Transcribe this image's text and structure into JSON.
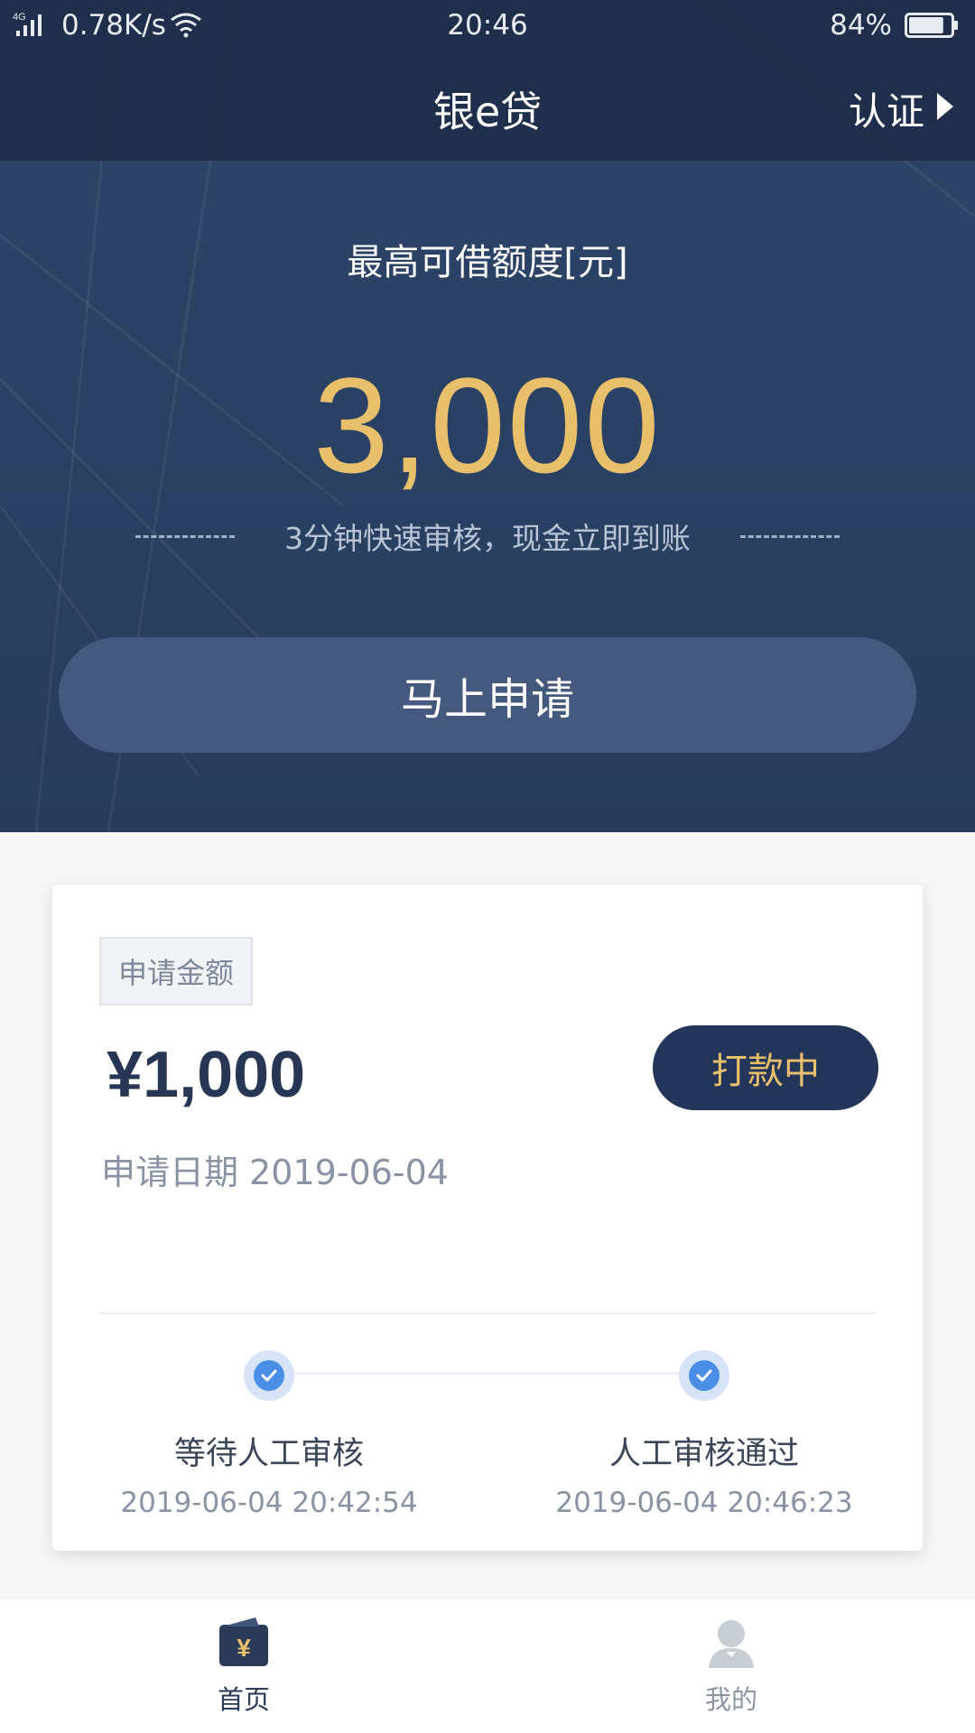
{
  "status_bar": {
    "network_type": "4G",
    "net_speed": "0.78K/s",
    "time": "20:46",
    "battery_percent": "84%",
    "battery_level": 0.84
  },
  "nav": {
    "title": "银e贷",
    "verify_label": "认证"
  },
  "hero": {
    "limit_label": "最高可借额度[元]",
    "limit_value": "3,000",
    "tagline": "3分钟快速审核，现金立即到账",
    "apply_button": "马上申请"
  },
  "card": {
    "amount_tag": "申请金额",
    "amount": "¥1,000",
    "status": "打款中",
    "apply_date_label": "申请日期",
    "apply_date": "2019-06-04",
    "steps": [
      {
        "label": "等待人工审核",
        "time": "2019-06-04 20:42:54"
      },
      {
        "label": "人工审核通过",
        "time": "2019-06-04 20:46:23"
      }
    ]
  },
  "tabbar": {
    "tabs": [
      {
        "label": "首页",
        "icon": "wallet-yen-icon"
      },
      {
        "label": "我的",
        "icon": "user-icon"
      }
    ]
  },
  "colors": {
    "hero_bg": "#2b4163",
    "accent_gold": "#e8c06c",
    "button_bg": "#44597d",
    "pill_bg": "#233659",
    "step_blue": "#4b8ee8"
  }
}
